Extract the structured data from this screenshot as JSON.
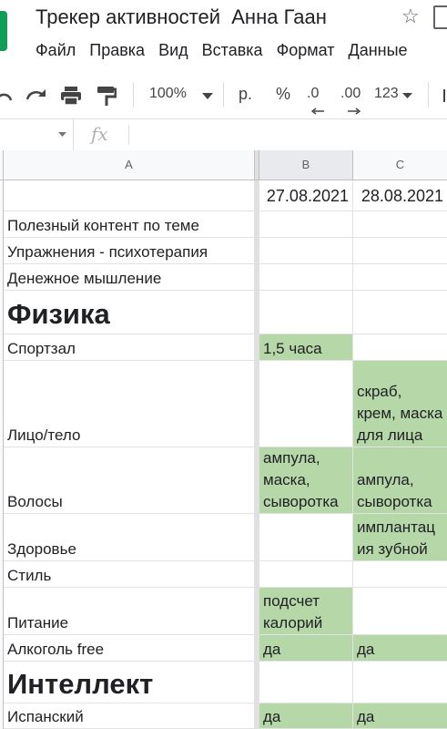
{
  "document": {
    "title": "Трекер активностей  Анна Гаан"
  },
  "menu": [
    "Файл",
    "Правка",
    "Вид",
    "Вставка",
    "Формат",
    "Данные"
  ],
  "toolbar": {
    "zoom": "100%",
    "currency": "р.",
    "percent": "%",
    "dec_decrease": ".0",
    "dec_increase": ".00",
    "number_format": "123"
  },
  "formula_bar": {
    "fx_label": "fx",
    "value": ""
  },
  "columns": [
    "A",
    "B",
    "C"
  ],
  "selected_column": "B",
  "rows": [
    {
      "a": "",
      "b": "27.08.2021",
      "c": "28.08.2021"
    },
    {
      "a": "Полезный контент по теме",
      "b": "",
      "c": ""
    },
    {
      "a": "Упражнения - психотерапия",
      "b": "",
      "c": ""
    },
    {
      "a": "Денежное мышление",
      "b": "",
      "c": ""
    },
    {
      "a": "Физика",
      "b": "",
      "c": ""
    },
    {
      "a": "Спортзал",
      "b": "1,5 часа",
      "c": ""
    },
    {
      "a": "Лицо/тело",
      "b": "",
      "c": "скраб, крем, маска для лица"
    },
    {
      "a": "Волосы",
      "b": "ампула, маска, сыворотка",
      "c": "ампула, сыворотка"
    },
    {
      "a": "Здоровье",
      "b": "",
      "c": "имплантация зубной"
    },
    {
      "a": "Стиль",
      "b": "",
      "c": ""
    },
    {
      "a": "Питание",
      "b": "подсчет калорий",
      "c": ""
    },
    {
      "a": "Алкоголь free",
      "b": "да",
      "c": "да"
    },
    {
      "a": "Интеллект",
      "b": "",
      "c": ""
    },
    {
      "a": "Испанский",
      "b": "да",
      "c": "да"
    }
  ],
  "colors": {
    "filled_cell": "#b6d7a8",
    "header_bg": "#f8f9fa",
    "logo": "#0f9d58"
  }
}
